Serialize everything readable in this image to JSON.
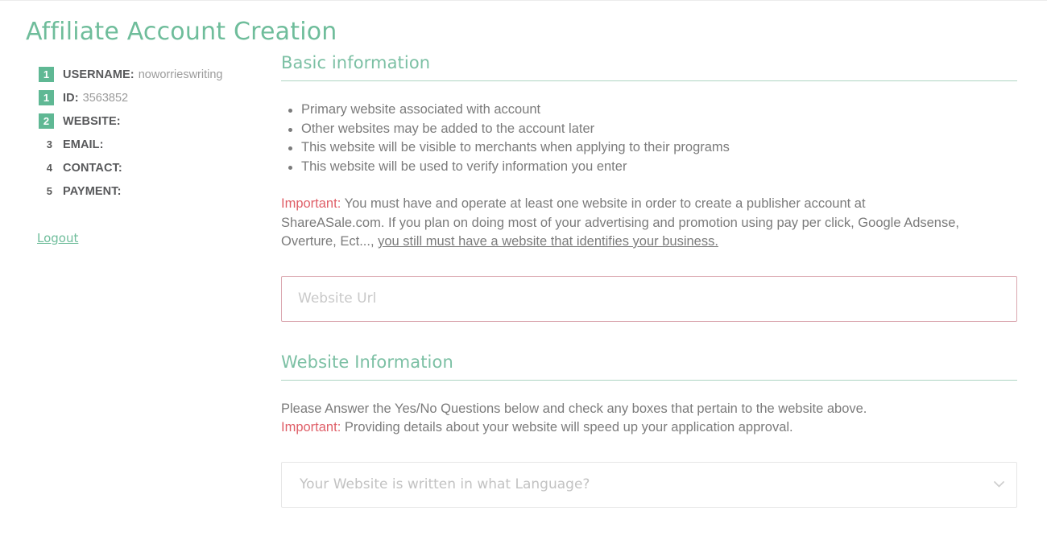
{
  "page": {
    "title": "Affiliate Account Creation"
  },
  "sidebar": {
    "steps": [
      {
        "number": "1",
        "state": "done",
        "label": "USERNAME:",
        "value": "noworrieswriting"
      },
      {
        "number": "1",
        "state": "done",
        "label": "ID:",
        "value": "3563852"
      },
      {
        "number": "2",
        "state": "done",
        "label": "WEBSITE:",
        "value": ""
      },
      {
        "number": "3",
        "state": "todo",
        "label": "EMAIL:",
        "value": ""
      },
      {
        "number": "4",
        "state": "todo",
        "label": "CONTACT:",
        "value": ""
      },
      {
        "number": "5",
        "state": "todo",
        "label": "PAYMENT:",
        "value": ""
      }
    ],
    "logout_label": "Logout"
  },
  "basic_information": {
    "heading": "Basic information",
    "bullets": [
      "Primary website associated with account",
      "Other websites may be added to the account later",
      "This website will be visible to merchants when applying to their programs",
      "This website will be used to verify information you enter"
    ],
    "important_tag": "Important:",
    "note_part1": " You must have and operate at least one website in order to create a publisher account at ShareASale.com. If you plan on doing most of your advertising and promotion using pay per click, Google Adsense, Overture, Ect..., ",
    "note_underlined": "you still must have a website that identifies your business.",
    "website_url_placeholder": "Website Url",
    "website_url_value": ""
  },
  "website_information": {
    "heading": "Website Information",
    "instruction": "Please Answer the Yes/No Questions below and check any boxes that pertain to the website above.",
    "important_tag": "Important:",
    "important_text": " Providing details about your website will speed up your application approval.",
    "language_select_placeholder": "Your Website is written in what Language?",
    "language_select_value": ""
  },
  "colors": {
    "brand_green": "#6fbd9b",
    "badge_green": "#5fb894",
    "rule_green": "#aed5c3",
    "important_red": "#df5f68",
    "error_border": "#dba8b0",
    "body_text": "#7b7b7b",
    "label_text": "#58595b"
  }
}
